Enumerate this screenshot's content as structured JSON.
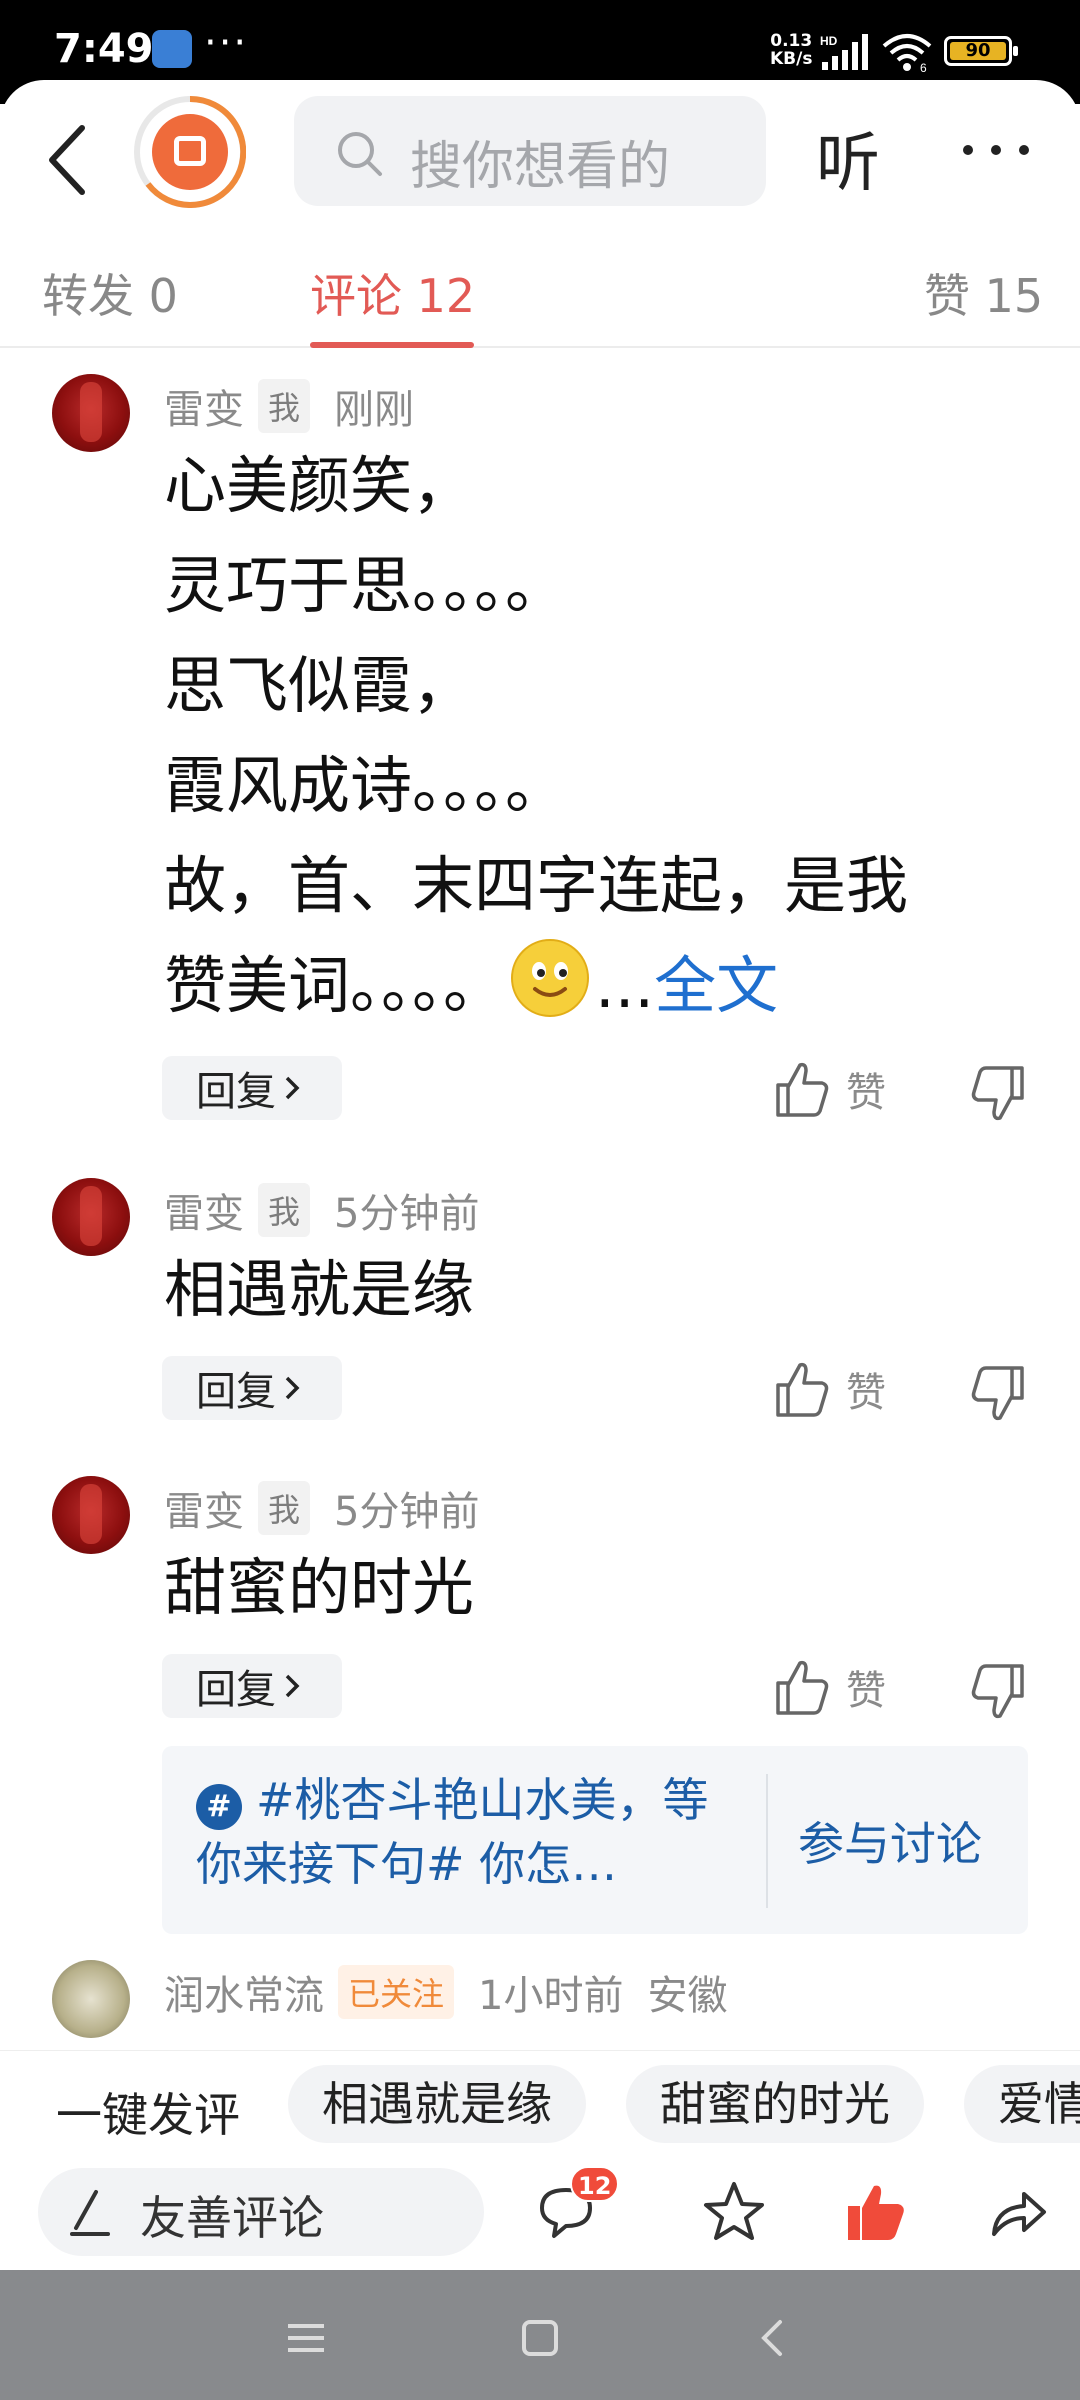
{
  "status": {
    "time": "7:49",
    "net_speed_top": "0.13",
    "net_speed_bottom": "KB/s",
    "battery": "90"
  },
  "header": {
    "search_placeholder": "搜你想看的",
    "listen_label": "听"
  },
  "tabs": [
    {
      "label": "转发 0"
    },
    {
      "label": "评论 12"
    },
    {
      "label": "赞 15"
    }
  ],
  "comments": [
    {
      "user": "雷变",
      "tag": "我",
      "time": "刚刚",
      "lines": [
        "心美颜笑，",
        "灵巧于思。。。。",
        "思飞似霞，",
        "霞风成诗。。。。",
        "故，首、末四字连起，是我",
        "赞美词。。。。"
      ],
      "ellipsis": "...",
      "fulltext": "全文",
      "reply": "回复",
      "like": "赞"
    },
    {
      "user": "雷变",
      "tag": "我",
      "time": "5分钟前",
      "lines": [
        "相遇就是缘"
      ],
      "reply": "回复",
      "like": "赞"
    },
    {
      "user": "雷变",
      "tag": "我",
      "time": "5分钟前",
      "lines": [
        "甜蜜的时光"
      ],
      "reply": "回复",
      "like": "赞"
    },
    {
      "user": "润水常流",
      "tag": "已关注",
      "time": "1小时前",
      "location": "安徽"
    }
  ],
  "topic": {
    "icon": "#",
    "text": "#桃杏斗艳山水美，等你来接下句# 你怎…",
    "join": "参与讨论"
  },
  "quick_reply": {
    "title": "一键发评",
    "chips": [
      "相遇就是缘",
      "甜蜜的时光",
      "爱情"
    ]
  },
  "input_bar": {
    "placeholder": "友善评论",
    "comment_badge": "12"
  },
  "icons": {
    "accent": "#e25a55",
    "link": "#1f6fcf",
    "topic": "#1c5da6"
  }
}
